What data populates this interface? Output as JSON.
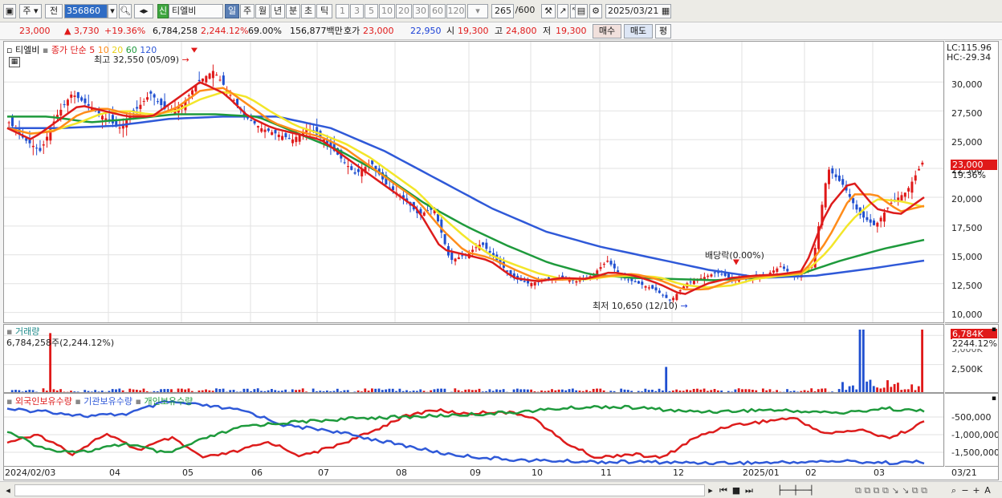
{
  "toolbar": {
    "market": "주",
    "prev_label": "전",
    "code": "356860",
    "name": "티엘비",
    "sin_badge": "신",
    "periods": [
      "일",
      "주",
      "월",
      "년",
      "분",
      "초",
      "틱"
    ],
    "active_period": "일",
    "intervals": [
      "1",
      "3",
      "5",
      "10",
      "20",
      "30",
      "60",
      "120"
    ],
    "count": "265",
    "count_max": "/600",
    "date": "2025/03/21"
  },
  "quote": {
    "price": "23,000",
    "change": "▲ 3,730",
    "change_pct": "+19.36%",
    "volume": "6,784,258",
    "volume_ratio": "2,244.12%",
    "turnover": "69.00%",
    "amount": "156,877백만",
    "ask_label": "호가",
    "ask": "23,000",
    "bid": "22,950",
    "open_label": "시",
    "open": "19,300",
    "high_label": "고",
    "high": "24,800",
    "low_label": "저",
    "low": "19,300",
    "buy_label": "매수",
    "sell_label": "매도",
    "eval_label": "평"
  },
  "price_panel": {
    "stock_label": "티엘비",
    "legend_title": "종가 단순",
    "ma_labels": [
      "5",
      "10",
      "20",
      "60",
      "120"
    ],
    "ma_colors": [
      "#dd1c1c",
      "#ff8c1a",
      "#f3e62a",
      "#1e9a3c",
      "#2f59d8"
    ],
    "high_annotation": "최고 32,550 (05/09)",
    "low_annotation": "최저 10,650 (12/10)",
    "dividend_annotation": "배당락(0.00%)",
    "lc": "LC:115.96",
    "hc": "HC:-29.34",
    "current_tag": "23,000",
    "current_pct": "19.36%"
  },
  "volume_panel": {
    "title": "거래량",
    "value": "6,784,258주(2,244.12%)",
    "tag": "6,784K",
    "tag_pct": "2244.12%",
    "axis_top": "5,000K",
    "axis_mid": "2,500K"
  },
  "holding_panel": {
    "legend": [
      "외국인보유수량",
      "기관보유수량",
      "개인보유수량"
    ],
    "colors": [
      "#dd1c1c",
      "#2f59d8",
      "#1e9a3c"
    ]
  },
  "chart_data": [
    {
      "type": "candlestick",
      "title": "티엘비",
      "ylim": [
        9000,
        33500
      ],
      "y_ticks": [
        "30,000",
        "27,500",
        "25,000",
        "22,500",
        "20,000",
        "17,500",
        "15,000",
        "12,500",
        "10,000"
      ],
      "x_ticks": [
        "2024/02/03",
        "04",
        "05",
        "06",
        "07",
        "08",
        "09",
        "10",
        "11",
        "12",
        "2025/01",
        "02",
        "03"
      ],
      "closes_approx": [
        26500,
        25000,
        24000,
        27000,
        29000,
        28000,
        27000,
        26000,
        27500,
        29000,
        27500,
        28000,
        30000,
        31000,
        29000,
        27000,
        26000,
        25500,
        25000,
        26000,
        25000,
        23500,
        22000,
        23000,
        21000,
        20000,
        18500,
        19000,
        14500,
        15000,
        16000,
        14500,
        13000,
        12500,
        12800,
        13000,
        12700,
        13200,
        14500,
        13000,
        12500,
        12000,
        11000,
        12500,
        13000,
        13500,
        12800,
        13000,
        13200,
        14000,
        13000,
        14000,
        22500,
        21000,
        18500,
        17500,
        19500,
        20500,
        23000
      ],
      "moving_averages": {
        "ma5": [
          26000,
          25000,
          26500,
          28000,
          27500,
          27000,
          27000,
          28500,
          30000,
          29000,
          27000,
          26000,
          25500,
          25000,
          23500,
          22000,
          20500,
          19000,
          15500,
          15000,
          14500,
          13000,
          12700,
          13000,
          12900,
          13500,
          13200,
          12500,
          11500,
          12500,
          13000,
          13200,
          13300,
          13600,
          19000,
          21500,
          19000,
          18500,
          20000
        ],
        "ma60": [
          27000,
          27000,
          26500,
          26800,
          27200,
          27200,
          27000,
          25500,
          24000,
          22000,
          19500,
          17500,
          15800,
          14300,
          13300,
          13000,
          12900,
          12800,
          13000,
          13300,
          14500,
          15500,
          16300
        ],
        "ma120": [
          26000,
          26000,
          26200,
          26800,
          27000,
          27000,
          26000,
          24000,
          21500,
          19000,
          17000,
          15700,
          14700,
          13700,
          13000,
          13200,
          13800,
          14500
        ]
      },
      "high": {
        "value": 32550,
        "date": "05/09"
      },
      "low": {
        "value": 10650,
        "date": "12/10"
      },
      "last": 23000
    },
    {
      "type": "bar",
      "title": "거래량",
      "ylim": [
        0,
        5500000
      ],
      "y_ticks": [
        "5,000K",
        "2,500K"
      ],
      "last": 6784258
    },
    {
      "type": "line",
      "series": [
        {
          "name": "외국인보유수량"
        },
        {
          "name": "기관보유수량"
        },
        {
          "name": "개인보유수량"
        }
      ],
      "y_ticks": [
        "-500,000",
        "-1,000,000",
        "-1,500,000"
      ]
    }
  ],
  "scroll": {
    "icons": [
      "play-icon",
      "first-icon",
      "stop-icon",
      "last-icon",
      "zoom-out-icon",
      "zoom-in-icon",
      "text-a-icon"
    ]
  }
}
